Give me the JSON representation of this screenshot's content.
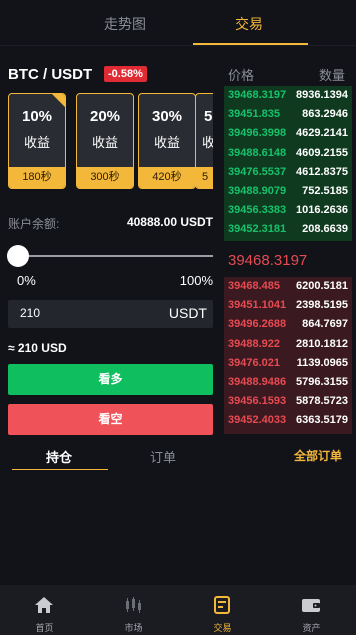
{
  "tabs": {
    "trend": "走势图",
    "trade": "交易"
  },
  "pair": "BTC / USDT",
  "change": "-0.58%",
  "cards": [
    {
      "pct": "10%",
      "label": "收益",
      "duration": "180秒",
      "selected": true
    },
    {
      "pct": "20%",
      "label": "收益",
      "duration": "300秒"
    },
    {
      "pct": "30%",
      "label": "收益",
      "duration": "420秒"
    },
    {
      "pct": "5",
      "label": "收",
      "duration": "5"
    }
  ],
  "balance": {
    "label": "账户余额:",
    "value": "40888.00 USDT"
  },
  "slider": {
    "min_label": "0%",
    "max_label": "100%",
    "value": 0
  },
  "amount": {
    "value": "210",
    "unit": "USDT"
  },
  "approx": "≈ 210 USD",
  "buttons": {
    "long": "看多",
    "short": "看空"
  },
  "bottom_tabs": {
    "positions": "持仓",
    "orders": "订单",
    "all_orders": "全部订单"
  },
  "orderbook": {
    "price_header": "价格",
    "qty_header": "数量",
    "bids": [
      {
        "price": "39468.3197",
        "qty": "8936.1394"
      },
      {
        "price": "39451.835",
        "qty": "863.2946"
      },
      {
        "price": "39496.3998",
        "qty": "4629.2141"
      },
      {
        "price": "39488.6148",
        "qty": "4609.2155"
      },
      {
        "price": "39476.5537",
        "qty": "4612.8375"
      },
      {
        "price": "39488.9079",
        "qty": "752.5185"
      },
      {
        "price": "39456.3383",
        "qty": "1016.2636"
      },
      {
        "price": "39452.3181",
        "qty": "208.6639"
      }
    ],
    "mid_price": "39468.3197",
    "asks": [
      {
        "price": "39468.485",
        "qty": "6200.5181"
      },
      {
        "price": "39451.1041",
        "qty": "2398.5195"
      },
      {
        "price": "39496.2688",
        "qty": "864.7697"
      },
      {
        "price": "39488.922",
        "qty": "2810.1812"
      },
      {
        "price": "39476.021",
        "qty": "1139.0965"
      },
      {
        "price": "39488.9486",
        "qty": "5796.3155"
      },
      {
        "price": "39456.1593",
        "qty": "5878.5723"
      },
      {
        "price": "39452.4033",
        "qty": "6363.5179"
      }
    ]
  },
  "tabbar": [
    {
      "label": "首页",
      "icon": "home-icon"
    },
    {
      "label": "市场",
      "icon": "candlestick-icon"
    },
    {
      "label": "交易",
      "icon": "trade-icon",
      "active": true
    },
    {
      "label": "资产",
      "icon": "wallet-icon"
    }
  ],
  "colors": {
    "accent": "#f3b73a",
    "up": "#17c26b",
    "down": "#e84a52",
    "background": "#111319"
  }
}
